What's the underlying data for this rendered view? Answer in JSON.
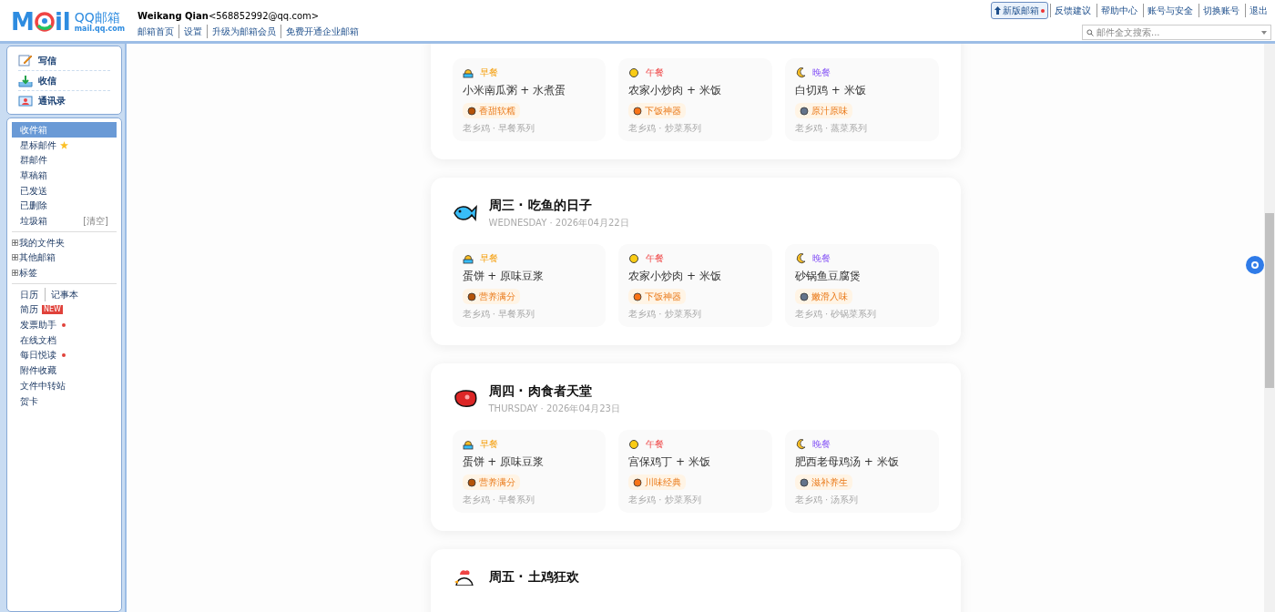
{
  "logo": {
    "left": "M",
    "right": "il",
    "brand": "QQ邮箱",
    "domain": "mail.qq.com"
  },
  "account": {
    "name": "Weikang Qian",
    "email": "<568852992@qq.com>"
  },
  "nav_links": [
    "邮箱首页",
    "设置",
    "升级为邮箱会员",
    "免费开通企业邮箱"
  ],
  "new_version": {
    "label": "新版邮箱",
    "dot": true
  },
  "top_links": [
    "反馈建议",
    "帮助中心",
    "账号与安全",
    "切换账号",
    "退出"
  ],
  "search": {
    "placeholder": "邮件全文搜索..."
  },
  "actions": [
    {
      "kind": "write",
      "label": "写信"
    },
    {
      "kind": "receive",
      "label": "收信"
    },
    {
      "kind": "contacts",
      "label": "通讯录"
    }
  ],
  "folders": [
    {
      "label": "收件箱",
      "selected": true
    },
    {
      "label": "星标邮件",
      "selected": false,
      "star": true
    },
    {
      "label": "群邮件",
      "selected": false
    },
    {
      "label": "草稿箱",
      "selected": false
    },
    {
      "label": "已发送",
      "selected": false
    },
    {
      "label": "已删除",
      "selected": false
    },
    {
      "label": "垃圾箱",
      "selected": false,
      "action": "[清空]"
    }
  ],
  "groups": [
    {
      "label": "我的文件夹",
      "expanded": false
    },
    {
      "label": "其他邮箱",
      "expanded": false
    },
    {
      "label": "标签",
      "expanded": false
    }
  ],
  "tools": [
    {
      "label": "日历",
      "extra": "记事本"
    },
    {
      "label": "简历",
      "badge": "NEW"
    },
    {
      "label": "发票助手",
      "dot": true
    },
    {
      "label": "在线文档"
    },
    {
      "label": "每日悦读",
      "dot": true
    },
    {
      "label": "附件收藏"
    },
    {
      "label": "文件中转站"
    },
    {
      "label": "贺卡"
    }
  ],
  "days": [
    {
      "meals": [
        {
          "kind": "breakfast",
          "label": "早餐",
          "dish": "小米南瓜粥 + 水煮蛋",
          "tag": "香甜软糯",
          "source": "老乡鸡 · 早餐系列"
        },
        {
          "kind": "lunch",
          "label": "午餐",
          "dish": "农家小炒肉 + 米饭",
          "tag": "下饭神器",
          "source": "老乡鸡 · 炒菜系列"
        },
        {
          "kind": "dinner",
          "label": "晚餐",
          "dish": "白切鸡 + 米饭",
          "tag": "原汁原味",
          "source": "老乡鸡 · 蒸菜系列"
        }
      ]
    },
    {
      "title": "周三 · 吃鱼的日子",
      "date": "WEDNESDAY · 2026年04月22日",
      "meals": [
        {
          "kind": "breakfast",
          "label": "早餐",
          "dish": "蛋饼 + 原味豆浆",
          "tag": "营养满分",
          "source": "老乡鸡 · 早餐系列"
        },
        {
          "kind": "lunch",
          "label": "午餐",
          "dish": "农家小炒肉 + 米饭",
          "tag": "下饭神器",
          "source": "老乡鸡 · 炒菜系列"
        },
        {
          "kind": "dinner",
          "label": "晚餐",
          "dish": "砂锅鱼豆腐煲",
          "tag": "嫩滑入味",
          "source": "老乡鸡 · 砂锅菜系列"
        }
      ]
    },
    {
      "title": "周四 · 肉食者天堂",
      "date": "THURSDAY · 2026年04月23日",
      "meals": [
        {
          "kind": "breakfast",
          "label": "早餐",
          "dish": "蛋饼 + 原味豆浆",
          "tag": "营养满分",
          "source": "老乡鸡 · 早餐系列"
        },
        {
          "kind": "lunch",
          "label": "午餐",
          "dish": "宫保鸡丁 + 米饭",
          "tag": "川味经典",
          "source": "老乡鸡 · 炒菜系列"
        },
        {
          "kind": "dinner",
          "label": "晚餐",
          "dish": "肥西老母鸡汤 + 米饭",
          "tag": "滋补养生",
          "source": "老乡鸡 · 汤系列"
        }
      ]
    },
    {
      "title": "周五 · 土鸡狂欢"
    }
  ]
}
